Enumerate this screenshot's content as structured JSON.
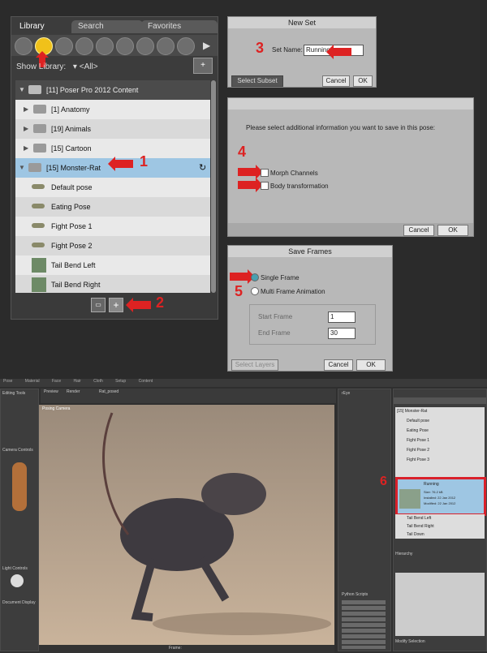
{
  "library": {
    "tabs": [
      "Library",
      "Search",
      "Favorites"
    ],
    "show_label": "Show Library:",
    "show_value": "<All>",
    "items": [
      {
        "label": "[11]   Poser Pro 2012 Content"
      },
      {
        "label": "[1]      Anatomy"
      },
      {
        "label": "[19]   Animals"
      },
      {
        "label": "[15]   Cartoon"
      },
      {
        "label": "[15]   Monster-Rat"
      },
      {
        "label": "Default pose"
      },
      {
        "label": "Eating Pose"
      },
      {
        "label": "Fight Pose 1"
      },
      {
        "label": "Fight Pose 2"
      },
      {
        "label": "Tail Bend Left"
      },
      {
        "label": "Tail Bend Right"
      }
    ],
    "plus": "+"
  },
  "new_set": {
    "title": "New Set",
    "set_name_label": "Set Name:",
    "set_name_value": "Running",
    "select_subset": "Select Subset",
    "cancel": "Cancel",
    "ok": "OK"
  },
  "pose_info": {
    "message": "Please select additional information you want to save in this pose:",
    "morph": "Morph Channels",
    "body": "Body transformation",
    "cancel": "Cancel",
    "ok": "OK"
  },
  "save_frames": {
    "title": "Save Frames",
    "single": "Single Frame",
    "multi": "Multi Frame Animation",
    "start_label": "Start Frame",
    "start_value": "1",
    "end_label": "End Frame",
    "end_value": "30",
    "select_layers": "Select Layers",
    "cancel": "Cancel",
    "ok": "OK"
  },
  "steps": [
    "1",
    "2",
    "3",
    "4",
    "5",
    "6"
  ],
  "shot": {
    "menu": [
      "Pose",
      "Material",
      "Face",
      "Hair",
      "Cloth",
      "Setup",
      "Content"
    ],
    "preview_tab": "Preview",
    "render_tab": "Render",
    "doc_title": "Rat_posed",
    "camera": "Posing Camera",
    "editing_tools": "Editing Tools",
    "camera_controls": "Camera Controls",
    "light_controls": "Light Controls",
    "document_display": "Document Display",
    "rat_label": "rEye",
    "frame_label": "Frame:",
    "running_name": "Running",
    "running_size": "Size: 76.2 kB",
    "running_installed": "Installed: 22 Jan 2012",
    "running_modified": "Modified: 22 Jan 2012",
    "lib_items": [
      "[15] Monster-Rat",
      "Default pose",
      "Eating Pose",
      "Fight Pose 1",
      "Fight Pose 2",
      "Fight Pose 3",
      "Tail Bend Left",
      "Tail Bend Right",
      "Tail Down"
    ],
    "hierarchy_title": "Hierarchy",
    "modify_selection": "Modify Selection",
    "python_scripts": "Python Scripts",
    "accent": "#d9202a"
  }
}
